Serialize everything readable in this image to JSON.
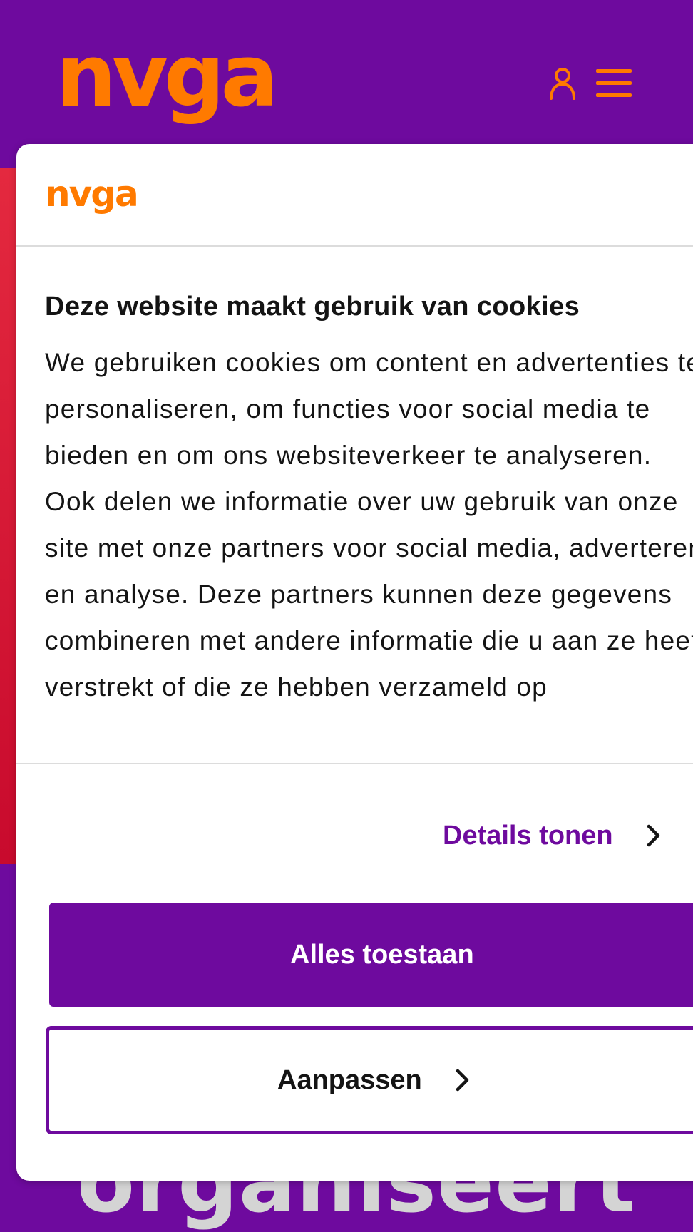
{
  "header": {
    "logo_text": "nvga",
    "account_icon": "user-icon",
    "menu_icon": "hamburger-menu-icon"
  },
  "hero": {
    "partial_text": "organiseert"
  },
  "cookie_dialog": {
    "logo_text": "nvga",
    "title": "Deze website maakt gebruik van cookies",
    "body": "We gebruiken cookies om content en advertenties te personaliseren, om functies voor social media te bieden en om ons websiteverkeer te analyseren. Ook delen we informatie over uw gebruik van onze site met onze partners voor social media, adverteren en analyse. Deze partners kunnen deze gegevens combineren met andere informatie die u aan ze heeft verstrekt of die ze hebben verzameld op",
    "details_label": "Details tonen",
    "allow_all_label": "Alles toestaan",
    "customize_label": "Aanpassen"
  },
  "colors": {
    "brand_purple": "#6e0a9e",
    "brand_orange": "#ff7a00",
    "accent_red": "#d0102e"
  }
}
